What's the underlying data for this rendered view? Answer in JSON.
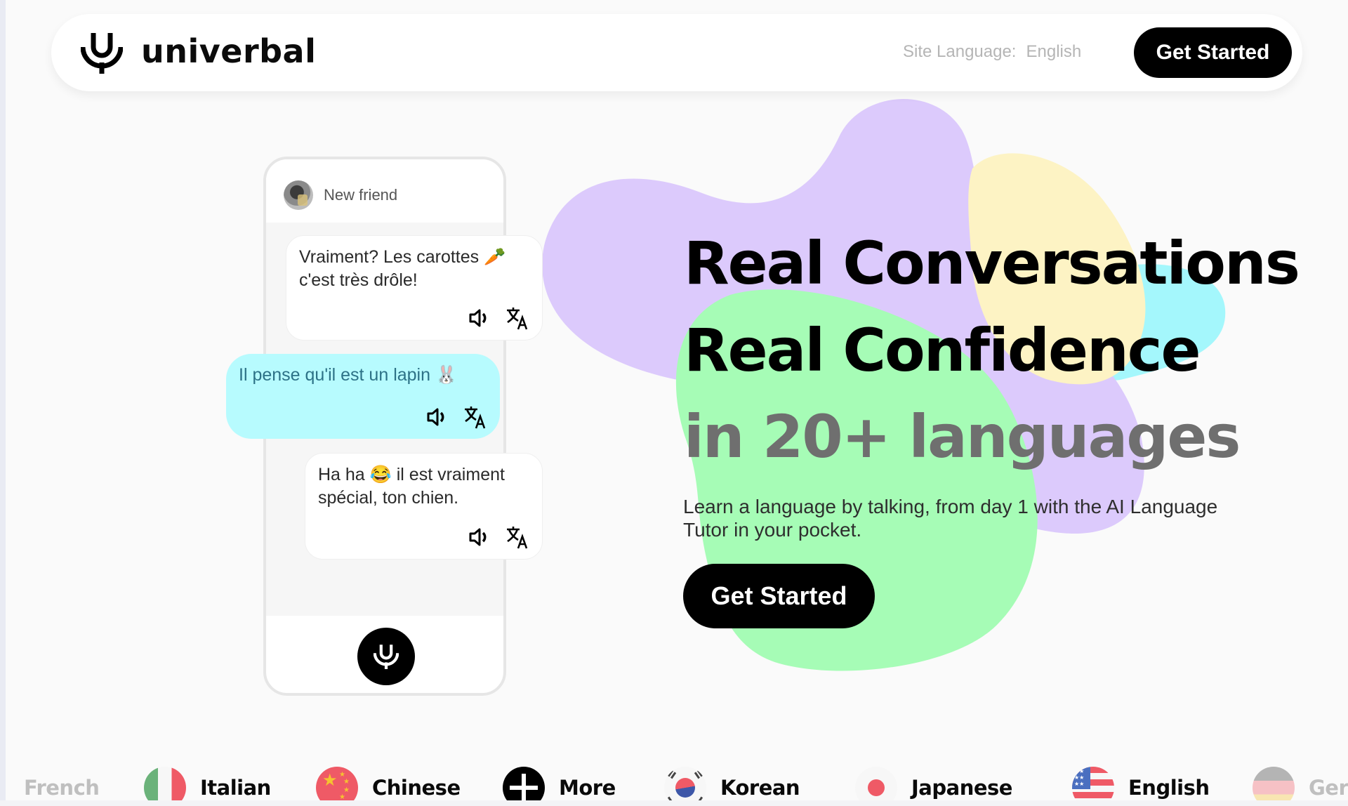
{
  "header": {
    "brand": "univerbal",
    "site_language_label": "Site Language:",
    "site_language_value": "English",
    "cta_label": "Get Started"
  },
  "phone": {
    "contact_name": "New friend",
    "messages": [
      {
        "text": "Vraiment? Les carottes 🥕 c'est très drôle!",
        "sender": "other"
      },
      {
        "text": "Il pense qu'il est un lapin 🐰",
        "sender": "me"
      },
      {
        "text": "Ha ha 😂 il est vraiment spécial, ton chien.",
        "sender": "other"
      }
    ],
    "icons": {
      "audio": "speaker-icon",
      "translate": "translate-icon",
      "mic": "univerbal-mic-icon"
    }
  },
  "hero": {
    "line1": "Real Conversations",
    "line2": "Real Confidence",
    "line3": "in 20+ languages",
    "subtitle": "Learn a language by talking, from day 1 with the AI Language Tutor in your pocket.",
    "cta_label": "Get Started"
  },
  "colors": {
    "purple": "#dccafc",
    "yellow": "#fdf3c4",
    "cyan": "#a4f7fc",
    "green": "#a6fcb6",
    "bubble_me": "#b7fbfe",
    "accent_text_me": "#2d7287"
  },
  "languages": [
    {
      "label": "French",
      "flag": "french-flag",
      "faded": true
    },
    {
      "label": "Italian",
      "flag": "italy-flag"
    },
    {
      "label": "Chinese",
      "flag": "china-flag"
    },
    {
      "label": "More",
      "flag": "plus-icon"
    },
    {
      "label": "Korean",
      "flag": "korea-flag"
    },
    {
      "label": "Japanese",
      "flag": "japan-flag"
    },
    {
      "label": "English",
      "flag": "usa-flag"
    },
    {
      "label": "Ger",
      "flag": "germany-flag",
      "faded": true
    }
  ]
}
